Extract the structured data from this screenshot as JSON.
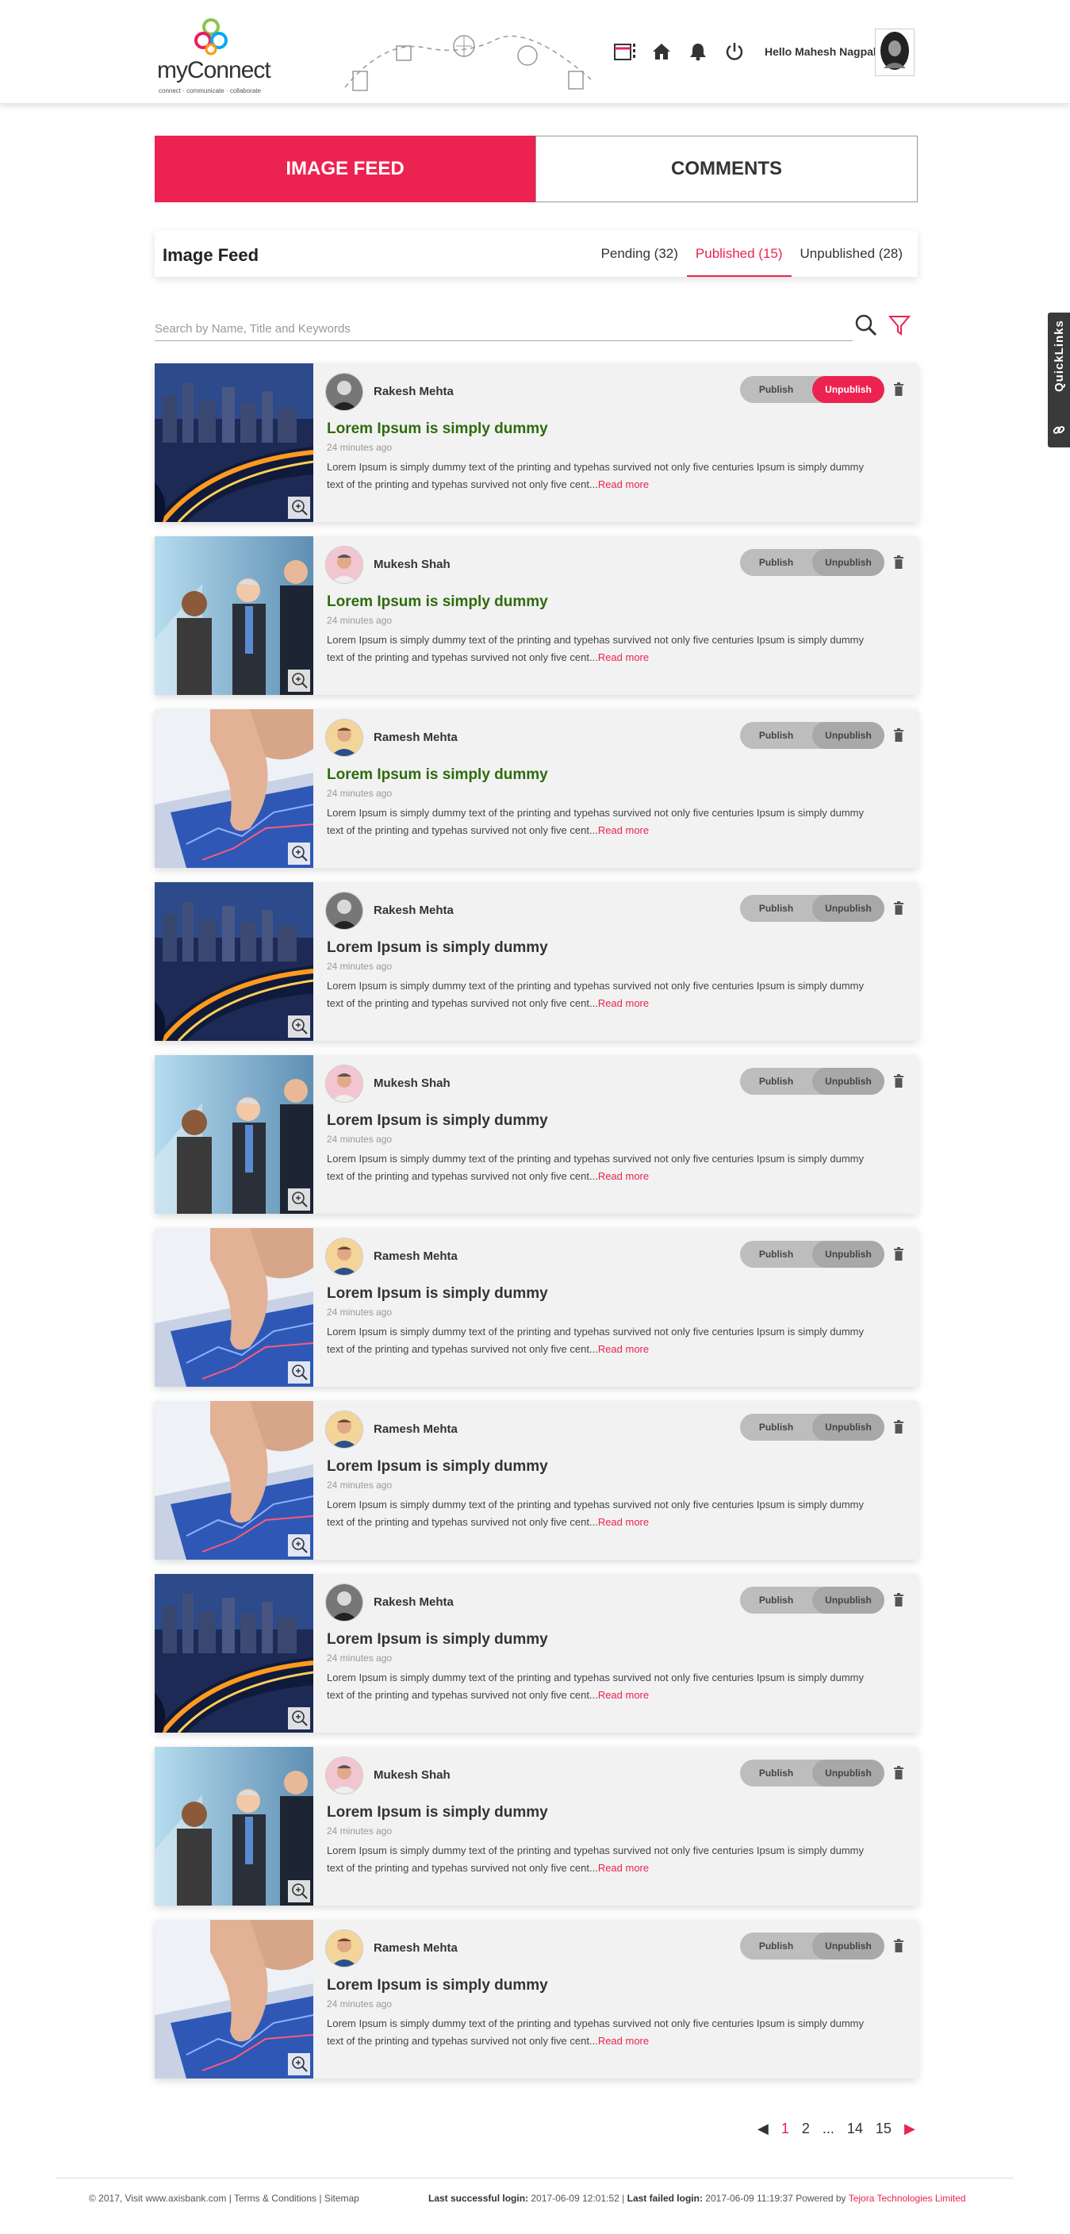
{
  "header": {
    "logo_text": "myConnect",
    "logo_tagline": "connect · communicate · collaborate",
    "greeting": "Hello Mahesh Nagpal",
    "icons": [
      "calendar-icon",
      "more-icon",
      "home-icon",
      "bell-icon",
      "power-icon"
    ]
  },
  "main_tabs": [
    {
      "label": "IMAGE FEED",
      "active": true
    },
    {
      "label": "COMMENTS",
      "active": false
    }
  ],
  "subhead": {
    "title": "Image Feed",
    "tabs": [
      {
        "label": "Pending (32)",
        "active": false
      },
      {
        "label": "Published (15)",
        "active": true
      },
      {
        "label": "Unpublished (28)",
        "active": false
      }
    ]
  },
  "search": {
    "placeholder": "Search by Name, Title and Keywords"
  },
  "quicklinks": {
    "label": "QuickLinks"
  },
  "actions": {
    "publish": "Publish",
    "unpublish": "Unpublish",
    "read_more": "Read more"
  },
  "cards": [
    {
      "author": "Rakesh Mehta",
      "title": "Lorem Ipsum is simply dummy",
      "time": "24 minutes ago",
      "body": "Lorem Ipsum is simply dummy text of the printing and typehas survived not only five centuries Ipsum is simply dummy text of the printing and typehas survived not only five cent...",
      "image": "city",
      "avatar": "rakesh",
      "title_color": "green",
      "unpublish_active": true
    },
    {
      "author": "Mukesh Shah",
      "title": "Lorem Ipsum is simply dummy",
      "time": "24 minutes ago",
      "body": "Lorem Ipsum is simply dummy text of the printing and typehas survived not only five centuries Ipsum is simply dummy text of the printing and typehas survived not only five cent...",
      "image": "business",
      "avatar": "mukesh",
      "title_color": "green",
      "unpublish_active": false
    },
    {
      "author": "Ramesh Mehta",
      "title": "Lorem Ipsum is simply dummy",
      "time": "24 minutes ago",
      "body": "Lorem Ipsum is simply dummy text of the printing and typehas survived not only five centuries Ipsum is simply dummy text of the printing and typehas survived not only five cent...",
      "image": "tablet",
      "avatar": "ramesh",
      "title_color": "green",
      "unpublish_active": false
    },
    {
      "author": "Rakesh Mehta",
      "title": "Lorem Ipsum is simply dummy",
      "time": "24 minutes ago",
      "body": "Lorem Ipsum is simply dummy text of the printing and typehas survived not only five centuries Ipsum is simply dummy text of the printing and typehas survived not only five cent...",
      "image": "city",
      "avatar": "rakesh",
      "title_color": "dark",
      "unpublish_active": false
    },
    {
      "author": "Mukesh Shah",
      "title": "Lorem Ipsum is simply dummy",
      "time": "24 minutes ago",
      "body": "Lorem Ipsum is simply dummy text of the printing and typehas survived not only five centuries Ipsum is simply dummy text of the printing and typehas survived not only five cent...",
      "image": "business",
      "avatar": "mukesh",
      "title_color": "dark",
      "unpublish_active": false
    },
    {
      "author": "Ramesh Mehta",
      "title": "Lorem Ipsum is simply dummy",
      "time": "24 minutes ago",
      "body": "Lorem Ipsum is simply dummy text of the printing and typehas survived not only five centuries Ipsum is simply dummy text of the printing and typehas survived not only five cent...",
      "image": "tablet",
      "avatar": "ramesh",
      "title_color": "dark",
      "unpublish_active": false
    },
    {
      "author": "Ramesh Mehta",
      "title": "Lorem Ipsum is simply dummy",
      "time": "24 minutes ago",
      "body": "Lorem Ipsum is simply dummy text of the printing and typehas survived not only five centuries Ipsum is simply dummy text of the printing and typehas survived not only five cent...",
      "image": "tablet",
      "avatar": "ramesh",
      "title_color": "dark",
      "unpublish_active": false
    },
    {
      "author": "Rakesh Mehta",
      "title": "Lorem Ipsum is simply dummy",
      "time": "24 minutes ago",
      "body": "Lorem Ipsum is simply dummy text of the printing and typehas survived not only five centuries Ipsum is simply dummy text of the printing and typehas survived not only five cent...",
      "image": "city",
      "avatar": "rakesh",
      "title_color": "dark",
      "unpublish_active": false
    },
    {
      "author": "Mukesh Shah",
      "title": "Lorem Ipsum is simply dummy",
      "time": "24 minutes ago",
      "body": "Lorem Ipsum is simply dummy text of the printing and typehas survived not only five centuries Ipsum is simply dummy text of the printing and typehas survived not only five cent...",
      "image": "business",
      "avatar": "mukesh",
      "title_color": "dark",
      "unpublish_active": false
    },
    {
      "author": "Ramesh Mehta",
      "title": "Lorem Ipsum is simply dummy",
      "time": "24 minutes ago",
      "body": "Lorem Ipsum is simply dummy text of the printing and typehas survived not only five centuries Ipsum is simply dummy text of the printing and typehas survived not only five cent...",
      "image": "tablet",
      "avatar": "ramesh",
      "title_color": "dark",
      "unpublish_active": false
    }
  ],
  "pagination": {
    "prev": "◀",
    "pages": [
      "1",
      "2",
      "...",
      "14",
      "15"
    ],
    "current": "1",
    "next": "▶"
  },
  "footer": {
    "copyright": "© 2017, Visit",
    "site_link": "www.axisbank.com",
    "terms": "Terms & Conditions",
    "sitemap": "Sitemap",
    "last_success_label": "Last successful login:",
    "last_success_value": "2017-06-09 12:01:52",
    "last_failed_label": "Last failed login:",
    "last_failed_value": "2017-06-09 11:19:37",
    "powered_by": "Powered by",
    "powered_company": "Tejora Technologies Limited"
  },
  "colors": {
    "accent": "#ec2350",
    "green_title": "#2e6b0d",
    "toggle": "#bdbdbd"
  }
}
